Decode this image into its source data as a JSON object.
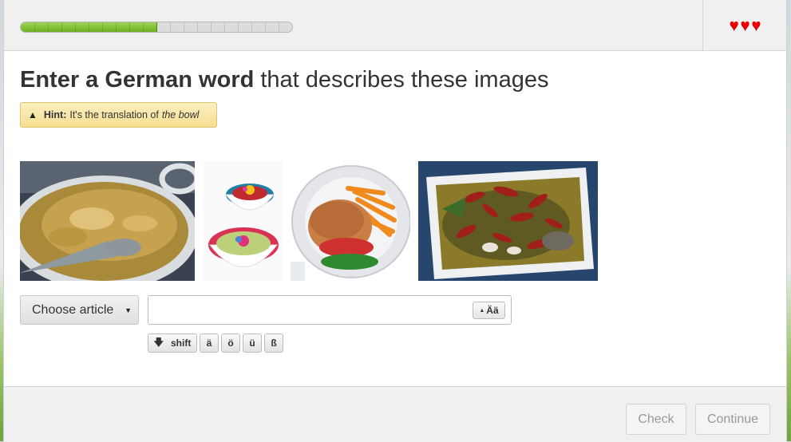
{
  "progress": {
    "completed": 10,
    "total": 20,
    "fraction": 0.5
  },
  "lives": {
    "count": 3,
    "icon": "heart-icon",
    "color": "#e00000"
  },
  "prompt": {
    "bold": "Enter a German word",
    "rest": " that describes these images"
  },
  "hint": {
    "icon": "warning-icon",
    "label": "Hint:",
    "text": "It's the translation of",
    "term": "the bowl"
  },
  "images": [
    {
      "subject": "curry in a bowl"
    },
    {
      "subject": "two small bowls with flowers"
    },
    {
      "subject": "plate with burger and fries"
    },
    {
      "subject": "spicy fish dish in a bowl"
    }
  ],
  "answer": {
    "article_placeholder": "Choose article",
    "value": "",
    "special_toggle_label": "Ää"
  },
  "special_keys": {
    "shift": "shift",
    "chars": [
      "ä",
      "ö",
      "ü",
      "ß"
    ]
  },
  "footer": {
    "check": "Check",
    "continue": "Continue"
  },
  "colors": {
    "progress_fill": "#7bc12c",
    "hint_bg": "#f8e7a8",
    "heart": "#e00000"
  }
}
